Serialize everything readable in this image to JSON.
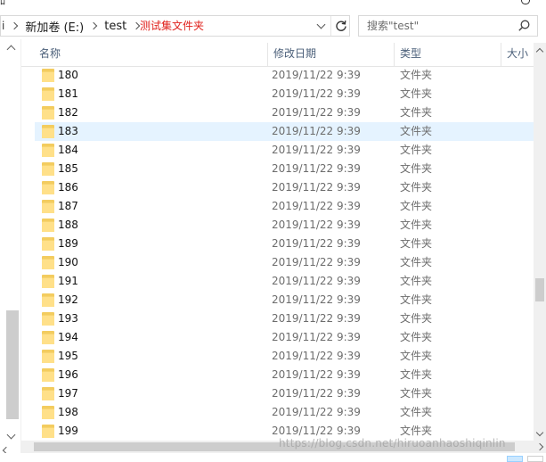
{
  "top": {
    "partial_title": "ﾛ"
  },
  "address_bar": {
    "leading_fragment": "i",
    "breadcrumbs": [
      "新加卷 (E:)",
      "test"
    ],
    "annotation": "测试集文件夹"
  },
  "search": {
    "placeholder": "搜索\"test\""
  },
  "columns": {
    "name": "名称",
    "date": "修改日期",
    "type": "类型",
    "size": "大小"
  },
  "files": [
    {
      "name": "180",
      "date": "2019/11/22 9:39",
      "type": "文件夹"
    },
    {
      "name": "181",
      "date": "2019/11/22 9:39",
      "type": "文件夹"
    },
    {
      "name": "182",
      "date": "2019/11/22 9:39",
      "type": "文件夹"
    },
    {
      "name": "183",
      "date": "2019/11/22 9:39",
      "type": "文件夹",
      "selected": true
    },
    {
      "name": "184",
      "date": "2019/11/22 9:39",
      "type": "文件夹"
    },
    {
      "name": "185",
      "date": "2019/11/22 9:39",
      "type": "文件夹"
    },
    {
      "name": "186",
      "date": "2019/11/22 9:39",
      "type": "文件夹"
    },
    {
      "name": "187",
      "date": "2019/11/22 9:39",
      "type": "文件夹"
    },
    {
      "name": "188",
      "date": "2019/11/22 9:39",
      "type": "文件夹"
    },
    {
      "name": "189",
      "date": "2019/11/22 9:39",
      "type": "文件夹"
    },
    {
      "name": "190",
      "date": "2019/11/22 9:39",
      "type": "文件夹"
    },
    {
      "name": "191",
      "date": "2019/11/22 9:39",
      "type": "文件夹"
    },
    {
      "name": "192",
      "date": "2019/11/22 9:39",
      "type": "文件夹"
    },
    {
      "name": "193",
      "date": "2019/11/22 9:39",
      "type": "文件夹"
    },
    {
      "name": "194",
      "date": "2019/11/22 9:39",
      "type": "文件夹"
    },
    {
      "name": "195",
      "date": "2019/11/22 9:39",
      "type": "文件夹"
    },
    {
      "name": "196",
      "date": "2019/11/22 9:39",
      "type": "文件夹"
    },
    {
      "name": "197",
      "date": "2019/11/22 9:39",
      "type": "文件夹"
    },
    {
      "name": "198",
      "date": "2019/11/22 9:39",
      "type": "文件夹"
    },
    {
      "name": "199",
      "date": "2019/11/22 9:39",
      "type": "文件夹"
    }
  ],
  "watermark": "https://blog.csdn.net/hiruoanhaoshiqinlin",
  "colors": {
    "selection": "#e5f3ff",
    "header_text": "#4c607a",
    "annotation": "#e0201b",
    "folder": "#ffe089"
  },
  "icons": [
    "chevron-right-icon",
    "chevron-down-icon",
    "refresh-icon",
    "search-icon",
    "folder-icon",
    "arrow-up-icon",
    "arrow-down-icon",
    "arrow-right-icon",
    "details-view-icon",
    "tiles-view-icon"
  ]
}
